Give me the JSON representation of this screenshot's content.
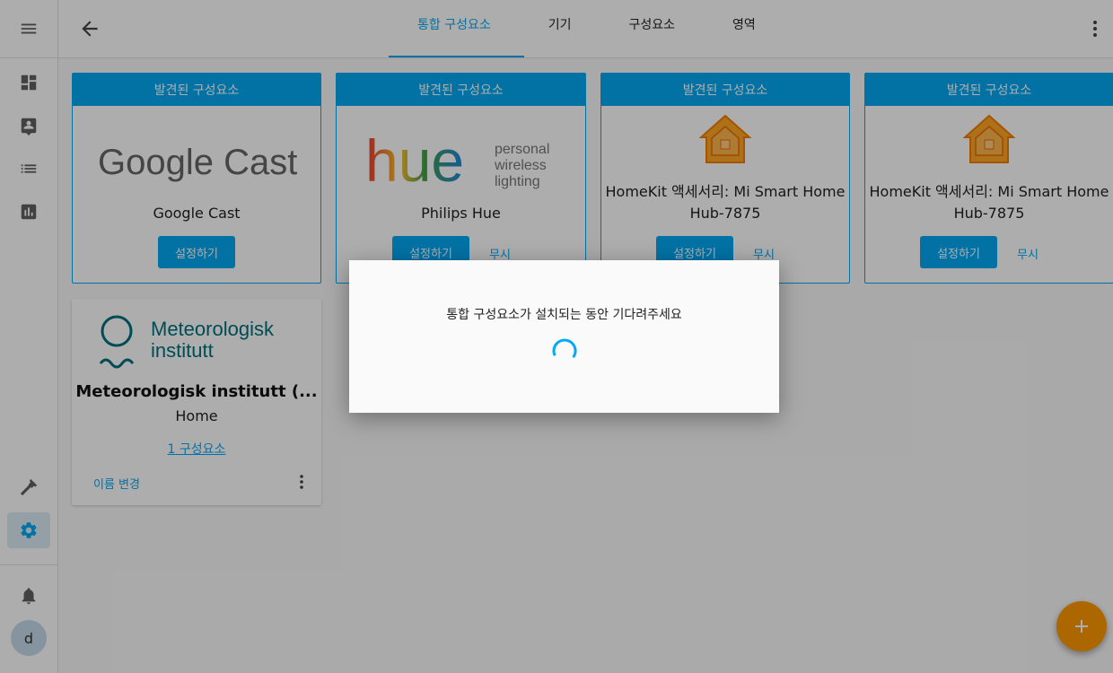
{
  "tabs": [
    {
      "label": "통합 구성요소"
    },
    {
      "label": "기기"
    },
    {
      "label": "구성요소"
    },
    {
      "label": "영역"
    }
  ],
  "discovered_cards": [
    {
      "header": "발견된 구성요소",
      "name": "Google Cast",
      "configure": "설정하기",
      "logo_text": "Google Cast"
    },
    {
      "header": "발견된 구성요소",
      "name": "Philips Hue",
      "configure": "설정하기",
      "ignore": "무시",
      "logo_text": "hue",
      "logo_sub": [
        "personal",
        "wireless",
        "lighting"
      ]
    },
    {
      "header": "발견된 구성요소",
      "name": "HomeKit 액세서리: Mi Smart Home Hub-7875",
      "configure": "설정하기",
      "ignore": "무시"
    },
    {
      "header": "발견된 구성요소",
      "name": "HomeKit 액세서리: Mi Smart Home Hub-7875",
      "configure": "설정하기",
      "ignore": "무시"
    }
  ],
  "configured_card": {
    "logo_text": [
      "Meteorologisk",
      "institutt"
    ],
    "title": "Meteorologisk institutt (...",
    "subtitle": "Home",
    "entities_link": "1 구성요소",
    "rename": "이름 변경"
  },
  "dialog": {
    "message": "통합 구성요소가 설치되는 동안 기다려주세요"
  },
  "user": {
    "avatar_letter": "d"
  },
  "colors": {
    "primary": "#03a9f4",
    "fab": "#ff9800",
    "homekit": "#ff9800"
  }
}
